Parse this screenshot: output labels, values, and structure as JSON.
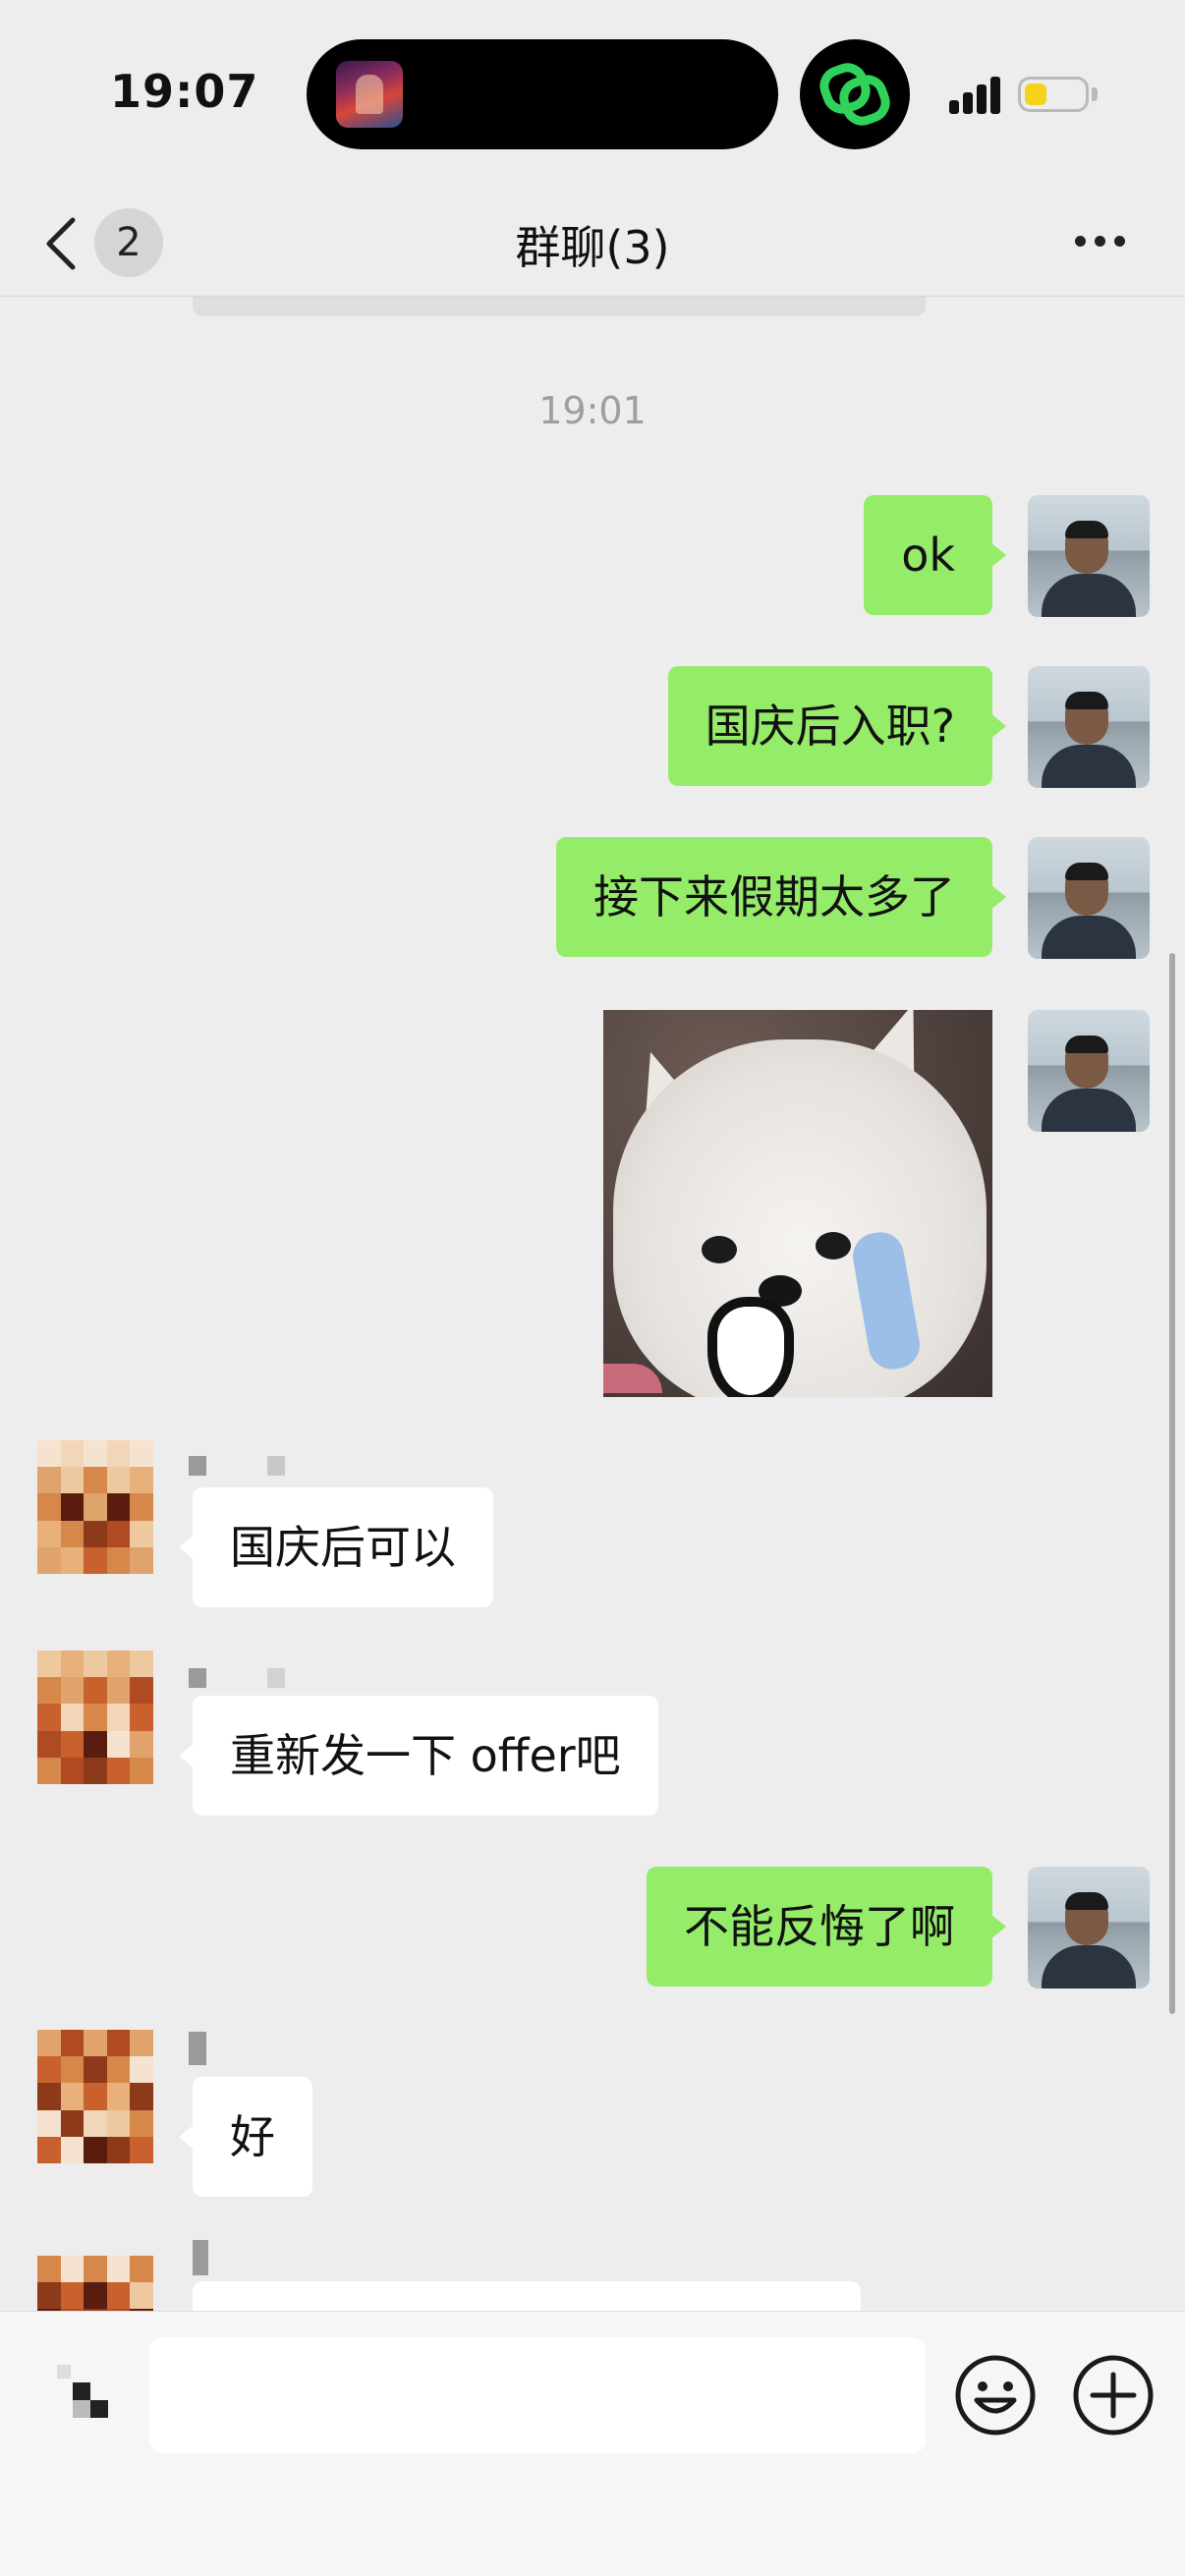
{
  "status_bar": {
    "time": "19:07"
  },
  "nav": {
    "back_count": "2",
    "title": "群聊(3)"
  },
  "timestamp": "19:01",
  "messages": [
    {
      "from": "me",
      "text": "ok"
    },
    {
      "from": "me",
      "text": "国庆后入职?"
    },
    {
      "from": "me",
      "text": "接下来假期太多了"
    },
    {
      "from": "me",
      "type": "sticker",
      "sticker": "crying-white-dog-sticker"
    },
    {
      "from": "other",
      "text": "国庆后可以"
    },
    {
      "from": "other",
      "text": "重新发一下 offer吧"
    },
    {
      "from": "me",
      "text": "不能反悔了啊"
    },
    {
      "from": "other",
      "text": "好"
    }
  ],
  "colors": {
    "sent_bubble": "#95ec69",
    "received_bubble": "#ffffff",
    "background": "#ededed"
  }
}
